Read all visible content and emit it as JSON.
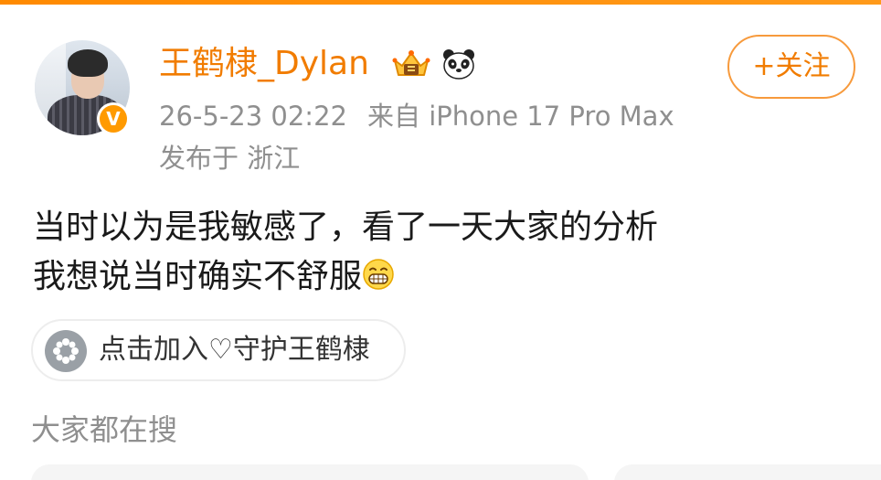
{
  "user": {
    "name": "王鹤棣_Dylan",
    "verified_mark": "V",
    "badges": [
      "crown-icon",
      "panda-icon"
    ]
  },
  "post": {
    "timestamp": "26-5-23 02:22",
    "source": "来自 iPhone 17 Pro Max",
    "location": "发布于 浙江",
    "lines": [
      "当时以为是我敏感了，看了一天大家的分析",
      "我想说当时确实不舒服"
    ],
    "emoji": "grin-emoji-icon"
  },
  "follow_button": {
    "label": "+关注"
  },
  "join_chip": {
    "label": "点击加入♡守护王鹤棣",
    "icon": "flower-icon"
  },
  "section": {
    "title": "大家都在搜"
  },
  "colors": {
    "accent": "#f17c00",
    "meta_text": "#8f8f8f",
    "body_text": "#1a1a1a"
  }
}
